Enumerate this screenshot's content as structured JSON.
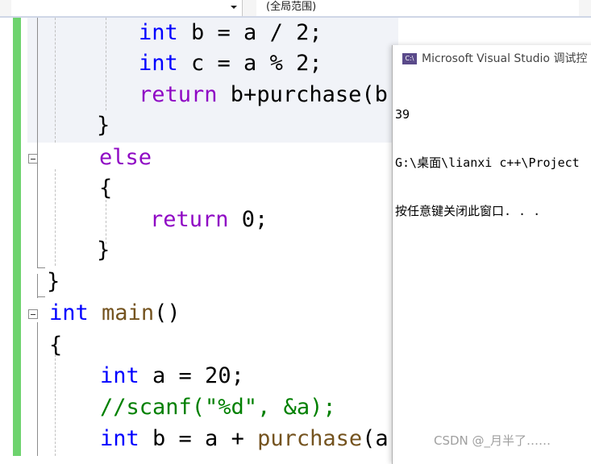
{
  "toolbar": {
    "scope_label": "(全局范围)"
  },
  "editor": {
    "lines": {
      "l1": {
        "kw": "int",
        "rest": " b = a / 2;"
      },
      "l2": {
        "kw": "int",
        "rest": " c = a % 2;"
      },
      "l3": {
        "kw": "return",
        "rest": " b+purchase(b"
      },
      "l4": {
        "text": "}"
      },
      "l5": {
        "kw": "else"
      },
      "l6": {
        "text": "{"
      },
      "l7": {
        "kw": "return",
        "rest": " 0;"
      },
      "l8": {
        "text": "}"
      },
      "l9": {
        "text": "}"
      },
      "l10": {
        "kw": "int",
        "fn": "main",
        "rest": "()"
      },
      "l11": {
        "text": "{"
      },
      "l12": {
        "kw": "int",
        "rest": " a = 20;"
      },
      "l13": {
        "comment": "//scanf(\"%d\", &a);"
      },
      "l14": {
        "kw": "int",
        "rest_a": " b = a + ",
        "fn": "purchase",
        "rest_b": "(a)"
      }
    }
  },
  "console": {
    "icon_text": "C:\\",
    "title": "Microsoft Visual Studio 调试控",
    "output": [
      "39",
      "G:\\桌面\\lianxi c++\\Project",
      "按任意键关闭此窗口. . ."
    ]
  },
  "watermark": "CSDN @_月半了……"
}
